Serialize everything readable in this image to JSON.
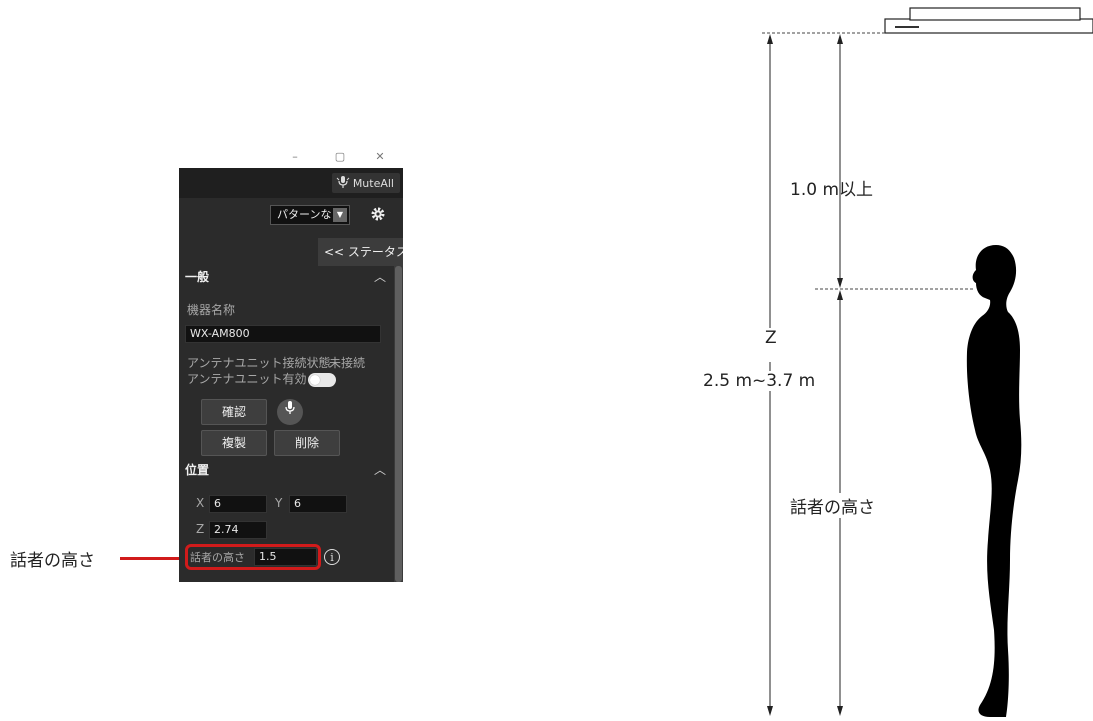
{
  "callout": {
    "label": "話者の高さ"
  },
  "window": {
    "controls": {
      "minimize": "–",
      "maximize": "▢",
      "close": "✕"
    },
    "muteall_label": "MuteAll",
    "pattern_select": "パターンなし",
    "status_tab": "<< ステータス",
    "general": {
      "header": "一般",
      "device_name_label": "機器名称",
      "device_name_value": "WX-AM800",
      "antenna_status_label": "アンテナユニット接続状態",
      "antenna_status_value": "未接続",
      "antenna_enabled_label": "アンテナユニット有効",
      "confirm_button": "確認",
      "duplicate_button": "複製",
      "delete_button": "削除"
    },
    "position": {
      "header": "位置",
      "x_label": "X",
      "x_value": "6",
      "y_label": "Y",
      "y_value": "6",
      "z_label": "Z",
      "z_value": "2.74",
      "speaker_height_label": "話者の高さ",
      "speaker_height_value": "1.5"
    }
  },
  "diagram": {
    "distance_label": "1.0 m以上",
    "z_label": "Z",
    "z_range_label": "2.5 m~3.7 m",
    "speaker_height_label": "話者の高さ"
  }
}
